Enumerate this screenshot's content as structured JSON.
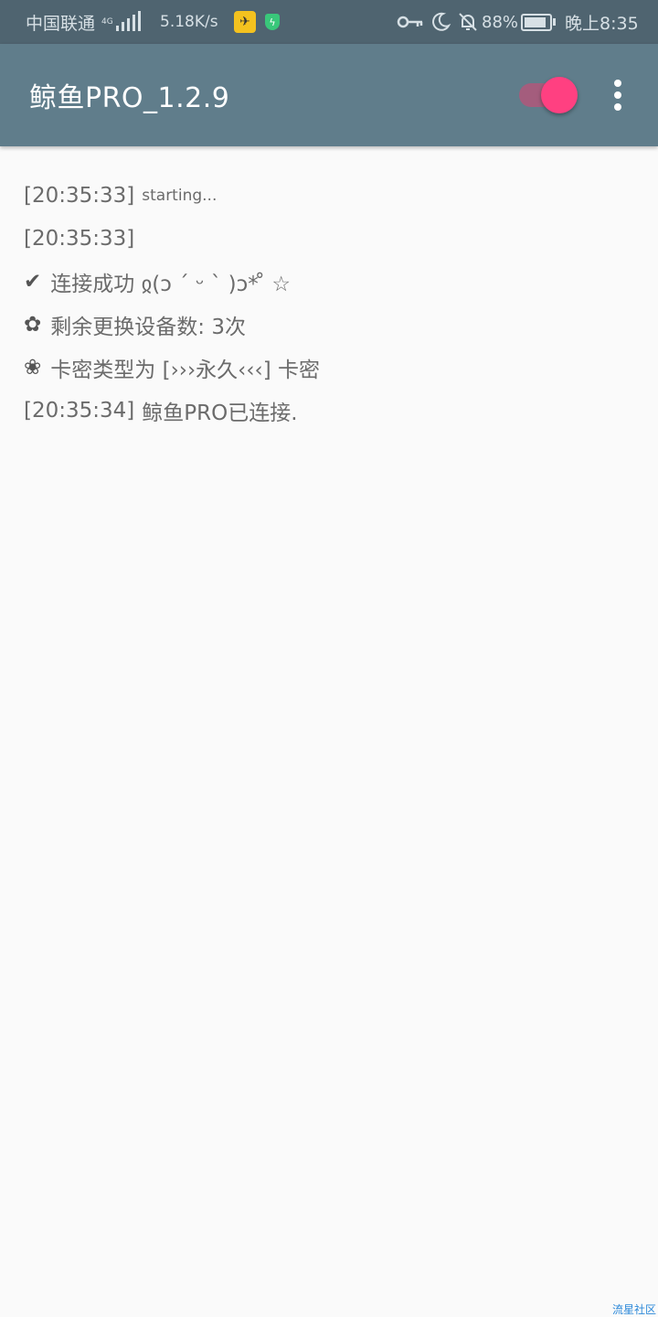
{
  "status_bar": {
    "carrier": "中国联通",
    "network_type": "4G",
    "speed": "5.18K/s",
    "battery": "88%",
    "battery_level": 0.88,
    "time": "晚上8:35",
    "icons": [
      "signal-icon",
      "app-notification-icon",
      "shield-icon",
      "key-icon",
      "moon-icon",
      "bell-off-icon",
      "battery-icon"
    ]
  },
  "app_bar": {
    "title": "鲸鱼PRO_1.2.9",
    "toggle_on": true,
    "accent_color": "#ff4081",
    "bar_color": "#607d8b"
  },
  "log": {
    "lines": [
      {
        "timestamp": "[20:35:33]",
        "text": "starting..."
      },
      {
        "timestamp": "[20:35:33]",
        "text": ""
      },
      {
        "symbol": "✔",
        "text": "连接成功 ჲ(ↄ ˊ ᵕ ˋ )ↄ* ̊ ☆"
      },
      {
        "symbol": "✿",
        "text": "剩余更换设备数: 3次"
      },
      {
        "symbol": "❀",
        "text": "卡密类型为 [›››永久‹‹‹] 卡密"
      },
      {
        "timestamp": "[20:35:34]",
        "text": "鲸鱼PRO已连接."
      }
    ]
  },
  "watermark": "流星社区"
}
